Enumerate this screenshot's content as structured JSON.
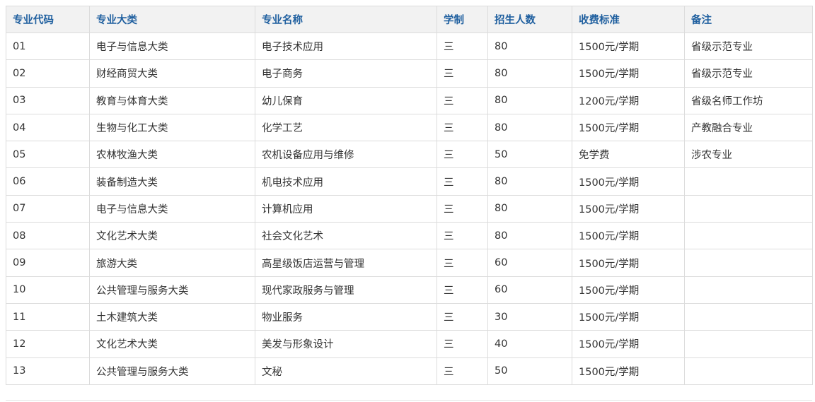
{
  "table": {
    "headers": [
      "专业代码",
      "专业大类",
      "专业名称",
      "学制",
      "招生人数",
      "收费标准",
      "备注"
    ],
    "rows": [
      [
        "01",
        "电子与信息大类",
        "电子技术应用",
        "三",
        "80",
        "1500元/学期",
        "省级示范专业"
      ],
      [
        "02",
        "财经商贸大类",
        "电子商务",
        "三",
        "80",
        "1500元/学期",
        "省级示范专业"
      ],
      [
        "03",
        "教育与体育大类",
        "幼儿保育",
        "三",
        "80",
        "1200元/学期",
        "省级名师工作坊"
      ],
      [
        "04",
        "生物与化工大类",
        "化学工艺",
        "三",
        "80",
        "1500元/学期",
        "产教融合专业"
      ],
      [
        "05",
        "农林牧渔大类",
        "农机设备应用与维修",
        "三",
        "50",
        "免学费",
        "涉农专业"
      ],
      [
        "06",
        "装备制造大类",
        "机电技术应用",
        "三",
        "80",
        "1500元/学期",
        ""
      ],
      [
        "07",
        "电子与信息大类",
        "计算机应用",
        "三",
        "80",
        "1500元/学期",
        ""
      ],
      [
        "08",
        "文化艺术大类",
        "社会文化艺术",
        "三",
        "80",
        "1500元/学期",
        ""
      ],
      [
        "09",
        "旅游大类",
        "高星级饭店运营与管理",
        "三",
        "60",
        "1500元/学期",
        ""
      ],
      [
        "10",
        "公共管理与服务大类",
        "现代家政服务与管理",
        "三",
        "60",
        "1500元/学期",
        ""
      ],
      [
        "11",
        "土木建筑大类",
        "物业服务",
        "三",
        "30",
        "1500元/学期",
        ""
      ],
      [
        "12",
        "文化艺术大类",
        "美发与形象设计",
        "三",
        "40",
        "1500元/学期",
        ""
      ],
      [
        "13",
        "公共管理与服务大类",
        "文秘",
        "三",
        "50",
        "1500元/学期",
        ""
      ]
    ]
  }
}
